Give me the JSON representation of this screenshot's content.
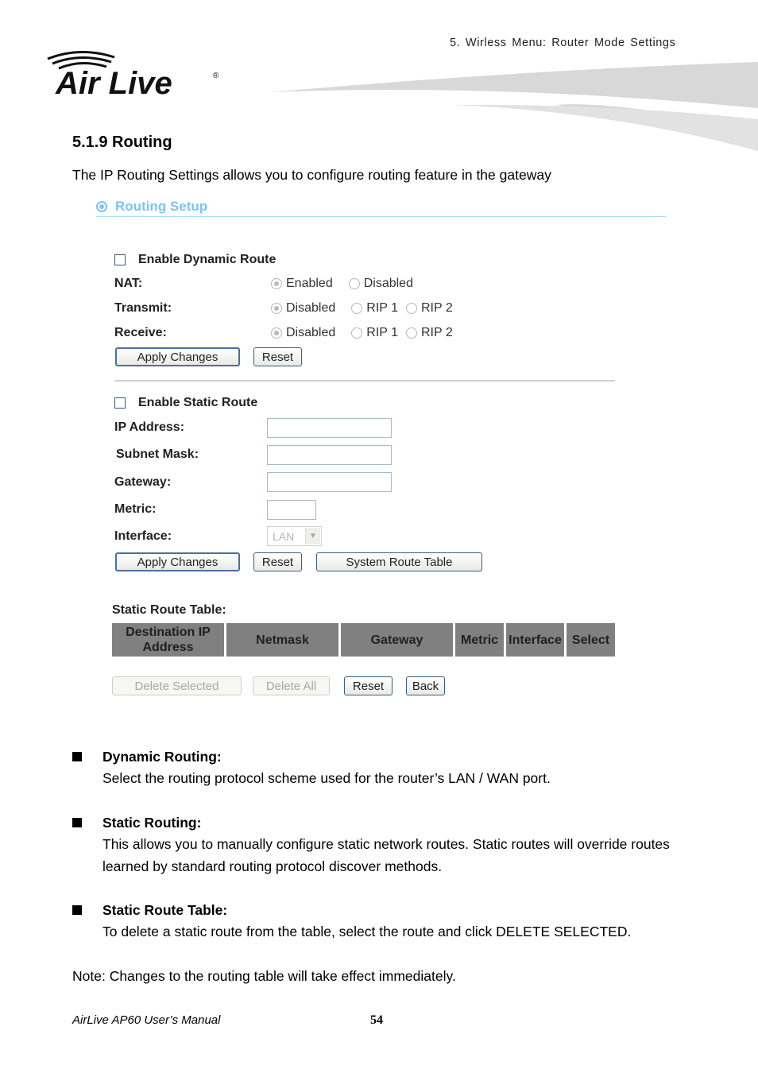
{
  "header": {
    "running_title": "5. Wirless Menu: Router Mode Settings",
    "logo_text": "Air Live",
    "logo_mark": "®"
  },
  "section": {
    "title": "5.1.9 Routing",
    "intro": "The IP Routing Settings allows you to configure routing feature in the gateway"
  },
  "ui": {
    "title": "Routing Setup",
    "accent_color": "#7cc5ec",
    "dynamic": {
      "enable_label": "Enable Dynamic Route",
      "enabled": false,
      "rows": [
        {
          "label": "NAT:",
          "options": [
            "Enabled",
            "Disabled"
          ],
          "selected": "Enabled"
        },
        {
          "label": "Transmit:",
          "options": [
            "Disabled",
            "RIP 1",
            "RIP 2"
          ],
          "selected": "Disabled"
        },
        {
          "label": "Receive:",
          "options": [
            "Disabled",
            "RIP 1",
            "RIP 2"
          ],
          "selected": "Disabled"
        }
      ],
      "apply_label": "Apply Changes",
      "reset_label": "Reset"
    },
    "static": {
      "enable_label": "Enable Static Route",
      "enabled": false,
      "ip_label": "IP Address:",
      "ip_value": "",
      "mask_label": "Subnet Mask:",
      "mask_value": "",
      "gateway_label": "Gateway:",
      "gateway_value": "",
      "metric_label": "Metric:",
      "metric_value": "",
      "interface_label": "Interface:",
      "interface_value": "LAN",
      "apply_label": "Apply Changes",
      "reset_label": "Reset",
      "system_route_label": "System Route Table"
    },
    "table": {
      "label": "Static Route Table:",
      "columns": [
        "Destination IP Address",
        "Netmask",
        "Gateway",
        "Metric",
        "Interface",
        "Select"
      ],
      "rows": [],
      "delete_selected_label": "Delete Selected",
      "delete_all_label": "Delete All",
      "reset_label": "Reset",
      "back_label": "Back"
    }
  },
  "bullets": [
    {
      "heading": "Dynamic Routing:",
      "text": "Select the routing protocol scheme used for the router’s LAN / WAN port."
    },
    {
      "heading": "Static Routing:",
      "text": "This allows you to manually configure static network routes. Static routes will override routes learned by standard routing protocol discover methods."
    },
    {
      "heading": "Static Route Table:",
      "text": "To delete a static route from the table, select the route and click DELETE SELECTED."
    }
  ],
  "note": "Note: Changes to the routing table will take effect immediately.",
  "footer": {
    "manual_name": "AirLive AP60 User’s Manual",
    "page_number": "54"
  }
}
